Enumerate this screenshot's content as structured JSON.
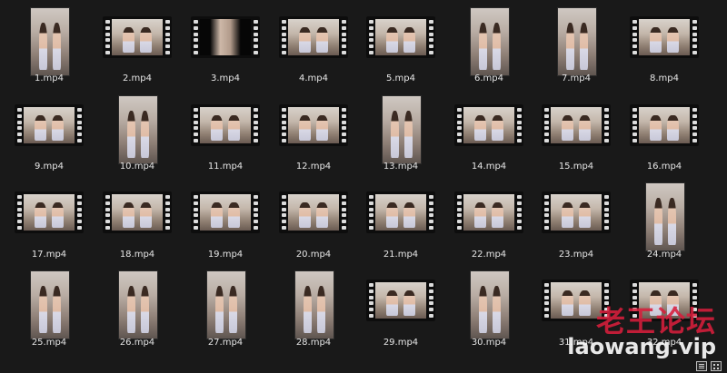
{
  "window": {
    "view": "large-icons"
  },
  "files": [
    {
      "name": "1.mp4",
      "orientation": "portrait"
    },
    {
      "name": "2.mp4",
      "orientation": "landscape"
    },
    {
      "name": "3.mp4",
      "orientation": "landscape",
      "dark": true
    },
    {
      "name": "4.mp4",
      "orientation": "landscape"
    },
    {
      "name": "5.mp4",
      "orientation": "landscape"
    },
    {
      "name": "6.mp4",
      "orientation": "portrait"
    },
    {
      "name": "7.mp4",
      "orientation": "portrait"
    },
    {
      "name": "8.mp4",
      "orientation": "landscape"
    },
    {
      "name": "9.mp4",
      "orientation": "landscape"
    },
    {
      "name": "10.mp4",
      "orientation": "portrait"
    },
    {
      "name": "11.mp4",
      "orientation": "landscape"
    },
    {
      "name": "12.mp4",
      "orientation": "landscape"
    },
    {
      "name": "13.mp4",
      "orientation": "portrait"
    },
    {
      "name": "14.mp4",
      "orientation": "landscape"
    },
    {
      "name": "15.mp4",
      "orientation": "landscape"
    },
    {
      "name": "16.mp4",
      "orientation": "landscape"
    },
    {
      "name": "17.mp4",
      "orientation": "landscape"
    },
    {
      "name": "18.mp4",
      "orientation": "landscape"
    },
    {
      "name": "19.mp4",
      "orientation": "landscape"
    },
    {
      "name": "20.mp4",
      "orientation": "landscape"
    },
    {
      "name": "21.mp4",
      "orientation": "landscape"
    },
    {
      "name": "22.mp4",
      "orientation": "landscape"
    },
    {
      "name": "23.mp4",
      "orientation": "landscape"
    },
    {
      "name": "24.mp4",
      "orientation": "portrait"
    },
    {
      "name": "25.mp4",
      "orientation": "portrait"
    },
    {
      "name": "26.mp4",
      "orientation": "portrait"
    },
    {
      "name": "27.mp4",
      "orientation": "portrait"
    },
    {
      "name": "28.mp4",
      "orientation": "portrait"
    },
    {
      "name": "29.mp4",
      "orientation": "landscape"
    },
    {
      "name": "30.mp4",
      "orientation": "portrait"
    },
    {
      "name": "31.mp4",
      "orientation": "landscape"
    },
    {
      "name": "32.mp4",
      "orientation": "landscape"
    }
  ],
  "watermark": {
    "chinese": "老王论坛",
    "domain": "laowang.vip",
    "color": "#d81e3c"
  },
  "statusbar": {
    "details_view_icon": "details-view-icon",
    "large_icons_view_icon": "large-icons-view-icon"
  }
}
